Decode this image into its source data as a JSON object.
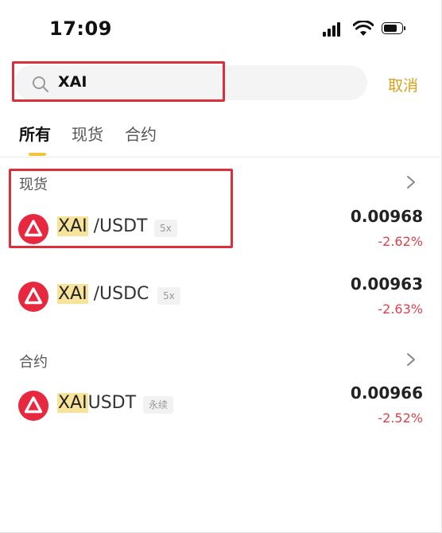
{
  "status_bar": {
    "time": "17:09"
  },
  "search": {
    "query": "XAI",
    "cancel_label": "取消"
  },
  "tabs": [
    {
      "label": "所有",
      "active": true
    },
    {
      "label": "现货",
      "active": false
    },
    {
      "label": "合约",
      "active": false
    }
  ],
  "sections": {
    "spot": {
      "title": "现货",
      "rows": [
        {
          "base": "XAI",
          "quote": "/USDT",
          "badge": "5x",
          "price": "0.00968",
          "change": "-2.62%"
        },
        {
          "base": "XAI",
          "quote": "/USDC",
          "badge": "5x",
          "price": "0.00963",
          "change": "-2.63%"
        }
      ]
    },
    "futures": {
      "title": "合约",
      "rows": [
        {
          "base": "XAI",
          "quote": "USDT",
          "badge": "永续",
          "price": "0.00966",
          "change": "-2.52%"
        }
      ]
    }
  },
  "colors": {
    "accent": "#d6a21c",
    "negative": "#d9434f",
    "highlight": "#f8e39a",
    "annotation_box": "#d9303a",
    "coin_icon": "#e8283f"
  }
}
